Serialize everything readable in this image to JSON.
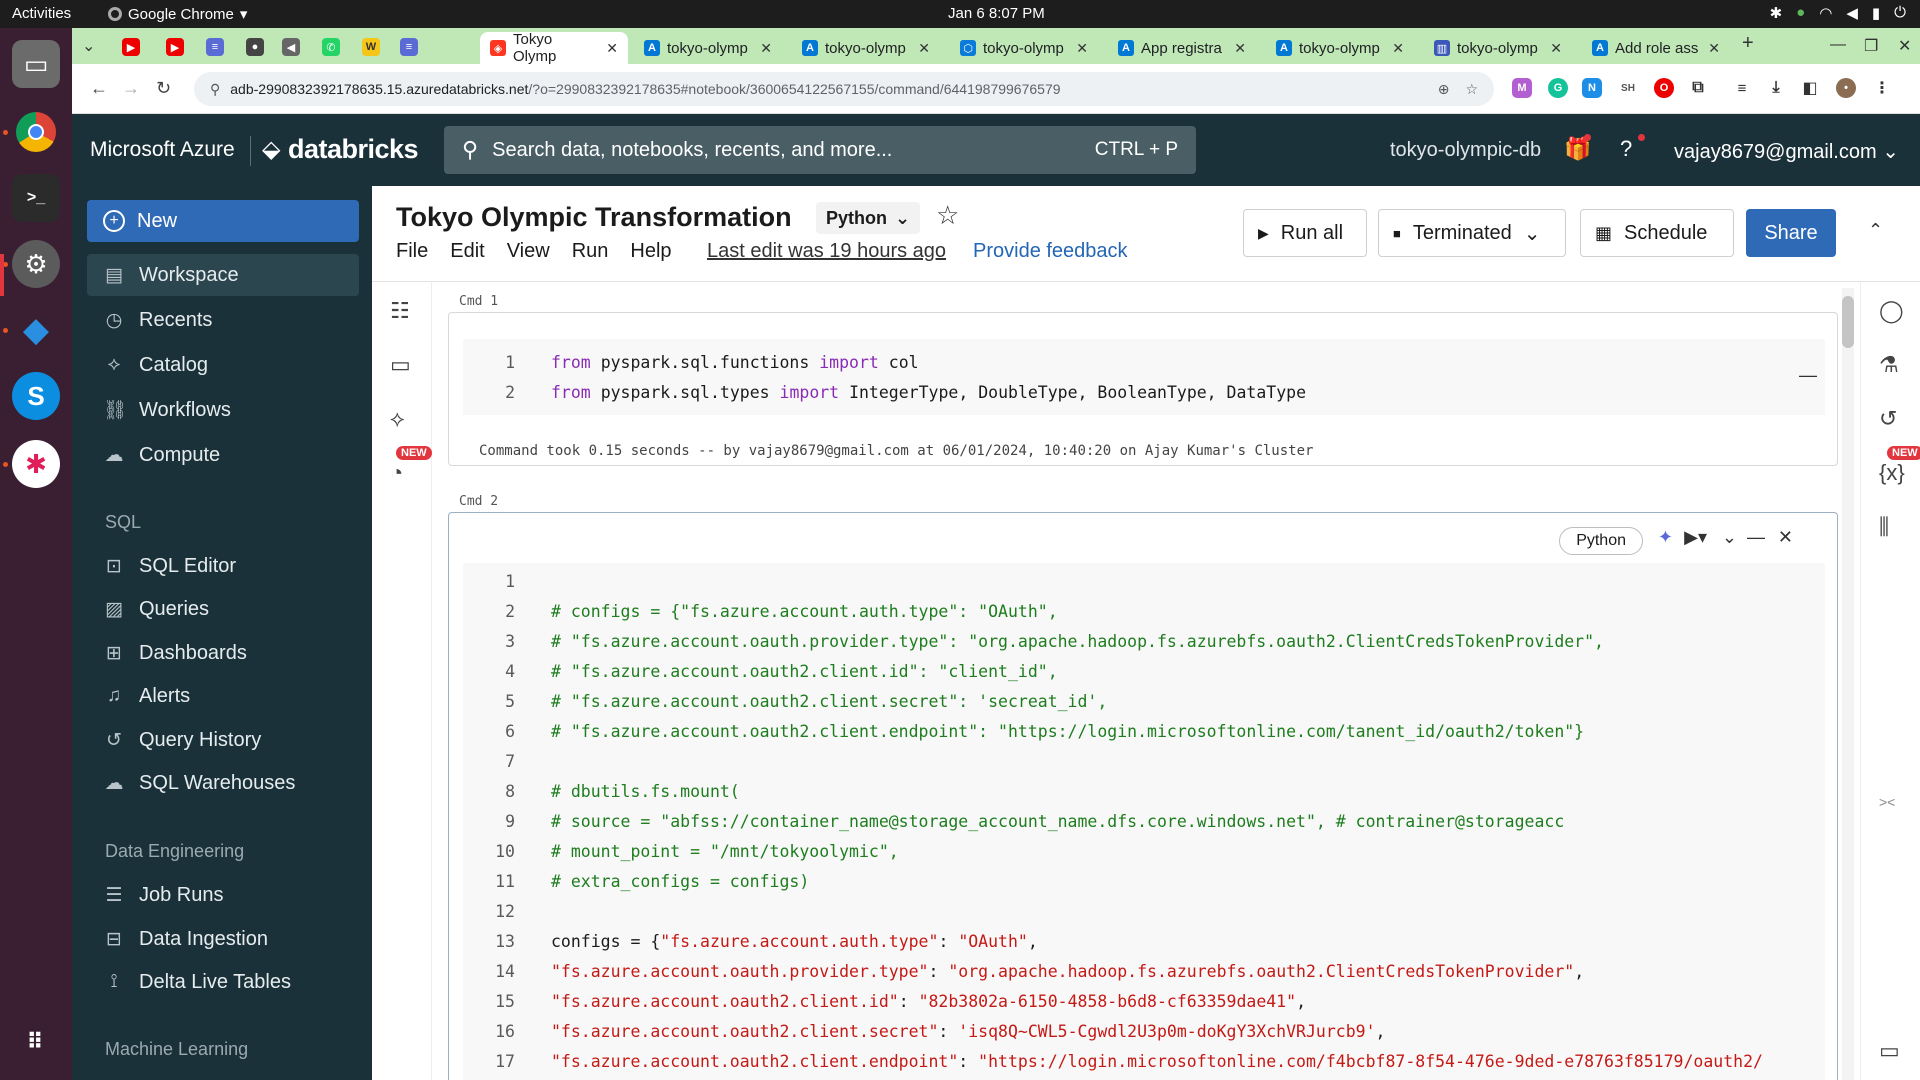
{
  "os": {
    "activities": "Activities",
    "app_name": "Google Chrome",
    "clock": "Jan 6  8:07 PM"
  },
  "tabs": [
    {
      "label": "Tokyo Olymp",
      "active": true
    },
    {
      "label": "tokyo-olymp"
    },
    {
      "label": "tokyo-olymp"
    },
    {
      "label": "tokyo-olymp"
    },
    {
      "label": "App registra"
    },
    {
      "label": "tokyo-olymp"
    },
    {
      "label": "tokyo-olymp"
    },
    {
      "label": "Add role ass"
    }
  ],
  "address": {
    "host": "adb-2990832392178635.15.azuredatabricks.net",
    "path": "/?o=2990832392178635#notebook/3600654122567155/command/644198799676579"
  },
  "header": {
    "azure": "Microsoft Azure",
    "logo": "databricks",
    "search_placeholder": "Search data, notebooks, recents, and more...",
    "search_shortcut": "CTRL + P",
    "workspace": "tokyo-olympic-db",
    "user": "vajay8679@gmail.com"
  },
  "sidebar": {
    "new_label": "New",
    "items_main": [
      "Workspace",
      "Recents",
      "Catalog",
      "Workflows",
      "Compute"
    ],
    "sql_section": "SQL",
    "items_sql": [
      "SQL Editor",
      "Queries",
      "Dashboards",
      "Alerts",
      "Query History",
      "SQL Warehouses"
    ],
    "de_section": "Data Engineering",
    "items_de": [
      "Job Runs",
      "Data Ingestion",
      "Delta Live Tables"
    ],
    "ml_section": "Machine Learning"
  },
  "notebook": {
    "title": "Tokyo Olympic Transformation",
    "language": "Python",
    "menu": [
      "File",
      "Edit",
      "View",
      "Run",
      "Help"
    ],
    "last_edit": "Last edit was 19 hours ago",
    "feedback": "Provide feedback",
    "run_all": "Run all",
    "cluster_state": "Terminated",
    "schedule": "Schedule",
    "share": "Share",
    "new_badge": "NEW"
  },
  "cmd1": {
    "label": "Cmd 1",
    "took": "Command took 0.15 seconds -- by vajay8679@gmail.com at 06/01/2024, 10:40:20 on Ajay Kumar's Cluster"
  },
  "cmd2": {
    "label": "Cmd 2",
    "language": "Python"
  }
}
